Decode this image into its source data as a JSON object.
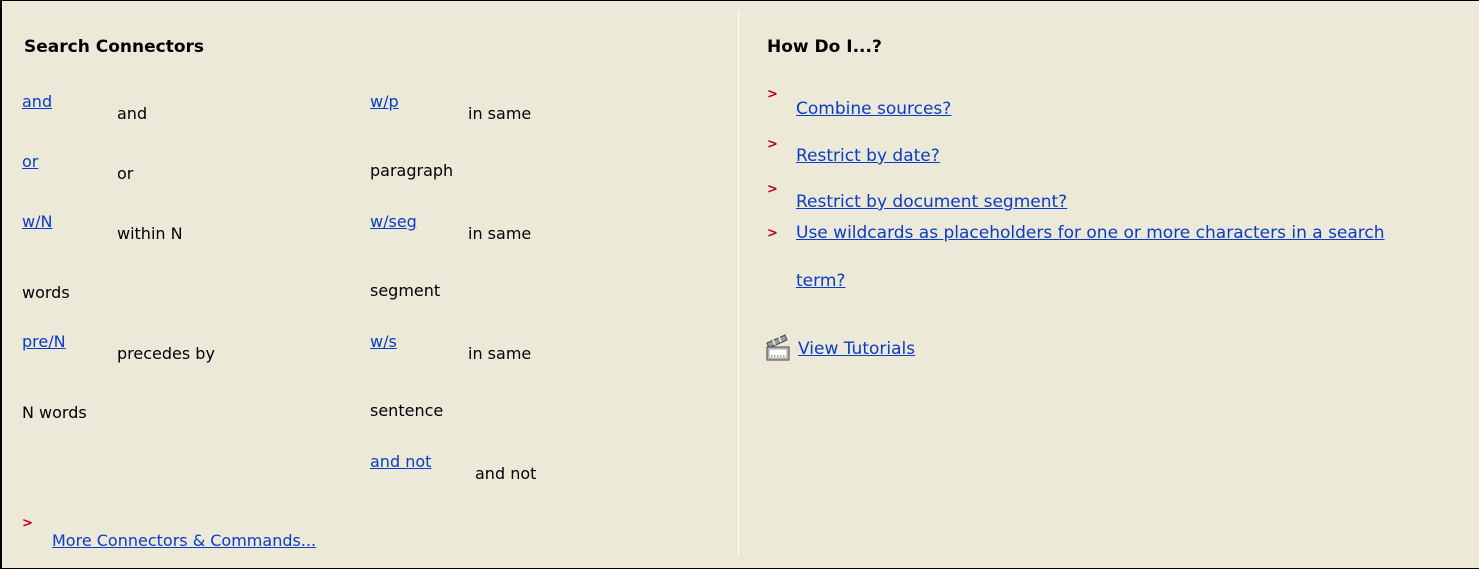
{
  "search_connectors": {
    "heading": "Search Connectors",
    "left": [
      {
        "term": "and",
        "desc": "and"
      },
      {
        "term": "or",
        "desc": "or"
      },
      {
        "term": "w/N",
        "desc": "within N",
        "desc_cont": "words"
      },
      {
        "term": "pre/N",
        "desc": "precedes by",
        "desc_cont": "N words"
      }
    ],
    "right": [
      {
        "term": "w/p",
        "desc": "in same",
        "desc_cont": "paragraph"
      },
      {
        "term": "w/seg",
        "desc": "in same",
        "desc_cont": "segment"
      },
      {
        "term": "w/s",
        "desc": "in same",
        "desc_cont": "sentence"
      },
      {
        "term": "and not",
        "desc": "and not"
      }
    ],
    "more_link": "More Connectors & Commands..."
  },
  "how_do_i": {
    "heading": "How Do I...?",
    "links": [
      "Combine sources?",
      "Restrict by date?",
      "Restrict by document segment?",
      "Use wildcards as placeholders for one or more characters in a search",
      "term?"
    ],
    "tutorials_link": "View Tutorials",
    "tutorials_icon": "clapperboard-icon"
  },
  "colors": {
    "background": "#ece9d8",
    "link": "#0a3cc4",
    "bullet": "#c00018"
  }
}
